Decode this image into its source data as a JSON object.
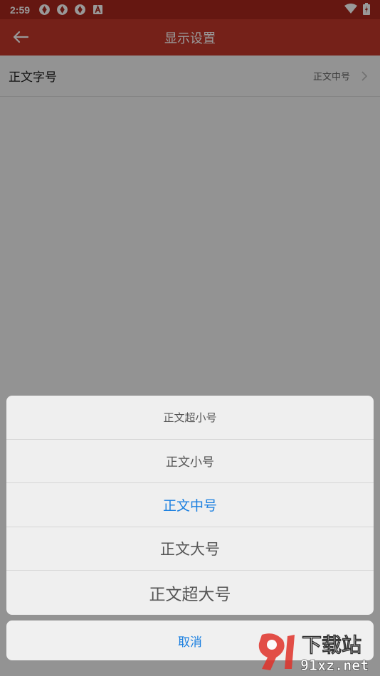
{
  "status_bar": {
    "time": "2:59",
    "left_icons": [
      "aperture-icon",
      "aperture-icon",
      "aperture-icon",
      "a-square-icon"
    ],
    "right_icons": [
      "wifi-icon",
      "battery-icon"
    ]
  },
  "app_bar": {
    "title": "显示设置",
    "back_icon": "arrow-left-icon",
    "color": "#c4372b"
  },
  "settings": {
    "rows": [
      {
        "label": "正文字号",
        "value": "正文中号"
      }
    ]
  },
  "sheet": {
    "options": [
      {
        "label": "正文超小号",
        "selected": false
      },
      {
        "label": "正文小号",
        "selected": false
      },
      {
        "label": "正文中号",
        "selected": true
      },
      {
        "label": "正文大号",
        "selected": false
      },
      {
        "label": "正文超大号",
        "selected": false
      }
    ],
    "cancel_label": "取消",
    "accent_color": "#1a7fe0"
  },
  "watermark": {
    "brand": "下载站",
    "domain": "91xz.net"
  }
}
